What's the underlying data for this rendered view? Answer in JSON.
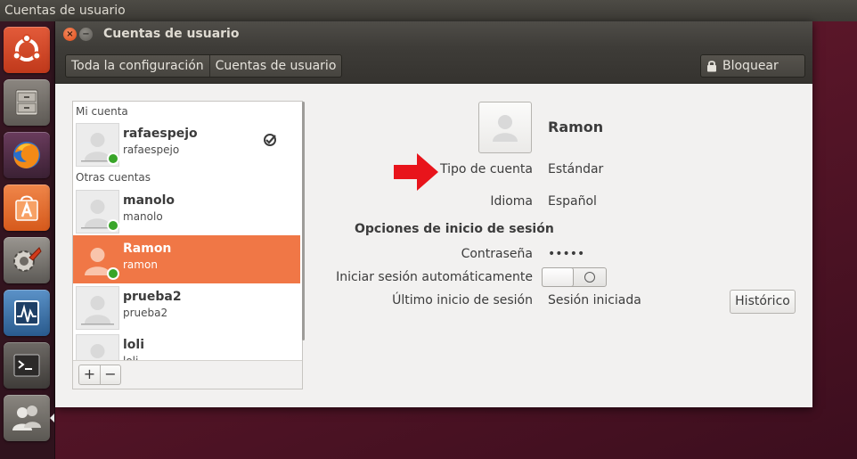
{
  "top_panel": {
    "title": "Cuentas de usuario"
  },
  "launcher": {
    "items": [
      {
        "name": "ubuntu-dash"
      },
      {
        "name": "files"
      },
      {
        "name": "firefox"
      },
      {
        "name": "software-center"
      },
      {
        "name": "system-settings"
      },
      {
        "name": "system-monitor"
      },
      {
        "name": "terminal"
      },
      {
        "name": "user-accounts"
      }
    ]
  },
  "window": {
    "title": "Cuentas de usuario",
    "close_symbol": "×",
    "minimize_symbol": "−"
  },
  "toolbar": {
    "breadcrumbs": [
      "Toda la configuración",
      "Cuentas de usuario"
    ],
    "lock_label": "Bloquear"
  },
  "user_list": {
    "my_account_label": "Mi cuenta",
    "other_accounts_label": "Otras cuentas",
    "users": [
      {
        "name": "rafaespejo",
        "login": "rafaespejo",
        "online": true,
        "current": true
      },
      {
        "name": "manolo",
        "login": "manolo",
        "online": true,
        "current": false
      },
      {
        "name": "Ramon",
        "login": "ramon",
        "online": true,
        "current": false,
        "selected": true
      },
      {
        "name": "prueba2",
        "login": "prueba2",
        "online": false,
        "current": false
      },
      {
        "name": "loli",
        "login": "loli",
        "online": false,
        "current": false
      }
    ],
    "add_label": "+",
    "remove_label": "−"
  },
  "details": {
    "name": "Ramon",
    "account_type_label": "Tipo de cuenta",
    "account_type_value": "Estándar",
    "language_label": "Idioma",
    "language_value": "Español",
    "login_options_title": "Opciones de inicio de sesión",
    "password_label": "Contraseña",
    "password_value": "•••••",
    "auto_login_label": "Iniciar sesión automáticamente",
    "auto_login_enabled": false,
    "last_login_label": "Último inicio de sesión",
    "last_login_value": "Sesión iniciada",
    "history_label": "Histórico"
  },
  "colors": {
    "selection": "#f07746",
    "online": "#39a529",
    "annotation_arrow": "#e8141b",
    "panel": "#3e3c38"
  }
}
